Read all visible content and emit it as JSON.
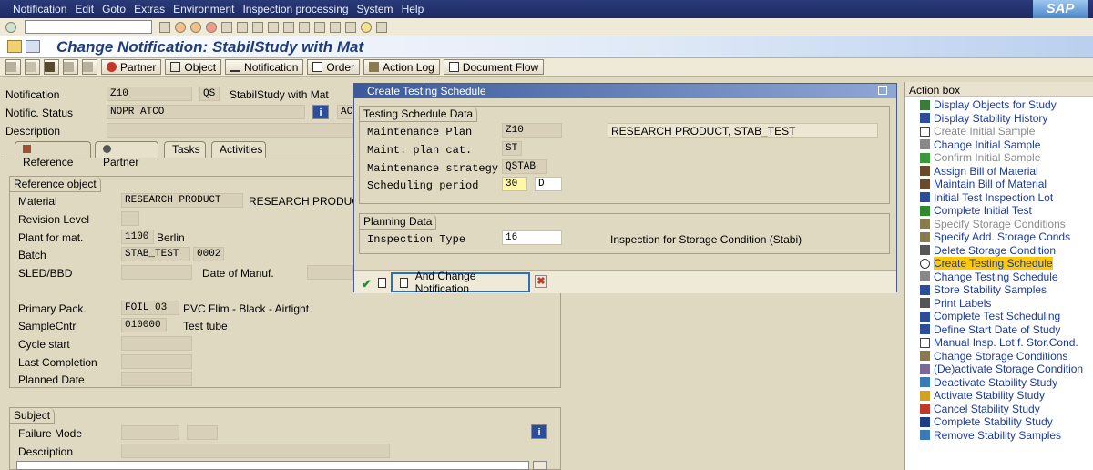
{
  "menu": [
    "Notification",
    "Edit",
    "Goto",
    "Extras",
    "Environment",
    "Inspection processing",
    "System",
    "Help"
  ],
  "brand": "SAP",
  "title": "Change Notification: StabilStudy with Mat",
  "toolbar": {
    "partner": "Partner",
    "object": "Object",
    "notification": "Notification",
    "order": "Order",
    "action_log": "Action Log",
    "document_flow": "Document Flow"
  },
  "header": {
    "notification_label": "Notification",
    "notification_value": "Z10",
    "notification_type": "QS",
    "notification_desc": "StabilStudy with Mat",
    "status_label": "Notific. Status",
    "status_value": "NOPR ATCO",
    "status_trunc": "AC",
    "description_label": "Description"
  },
  "tabs": [
    "Reference",
    "Partner",
    "Tasks",
    "Activities"
  ],
  "reference": {
    "title": "Reference object",
    "material_label": "Material",
    "material_value": "RESEARCH PRODUCT",
    "material_desc": "RESEARCH PRODUCT",
    "revision_label": "Revision Level",
    "plant_label": "Plant for mat.",
    "plant_value": "1100",
    "plant_desc": "Berlin",
    "batch_label": "Batch",
    "batch_value": "STAB_TEST",
    "batch_num": "0002",
    "sled_label": "SLED/BBD",
    "manuf_label": "Date of Manuf.",
    "pack_label": "Primary Pack.",
    "pack_value": "FOIL 03",
    "pack_desc": "PVC Flim - Black - Airtight",
    "sample_label": "SampleCntr",
    "sample_value": "010000",
    "sample_desc": "Test tube",
    "cycle_label": "Cycle start",
    "last_label": "Last Completion",
    "planned_label": "Planned Date"
  },
  "subject": {
    "title": "Subject",
    "failure_label": "Failure Mode",
    "desc_label": "Description"
  },
  "dialog": {
    "title": "Create Testing Schedule",
    "group1": "Testing Schedule Data",
    "mp_label": "Maintenance Plan",
    "mp_value": "Z10",
    "mp_desc": "RESEARCH PRODUCT, STAB_TEST",
    "cat_label": "Maint. plan cat.",
    "cat_value": "ST",
    "strat_label": "Maintenance strategy",
    "strat_value": "QSTAB",
    "period_label": "Scheduling period",
    "period_value": "30",
    "period_unit": "D",
    "group2": "Planning Data",
    "insp_label": "Inspection Type",
    "insp_value": "16",
    "insp_desc": "Inspection for Storage Condition (Stabi)",
    "change_btn": "And Change Notification"
  },
  "actionbox": {
    "title": "Action box",
    "items": [
      {
        "label": "Display Objects for Study",
        "enabled": true,
        "icon": "tree-icon"
      },
      {
        "label": "Display Stability History",
        "enabled": true,
        "icon": "history-icon"
      },
      {
        "label": "Create Initial Sample",
        "enabled": false,
        "icon": "page-icon"
      },
      {
        "label": "Change Initial Sample",
        "enabled": true,
        "icon": "pencil-icon"
      },
      {
        "label": "Confirm Initial Sample",
        "enabled": false,
        "icon": "flag-icon"
      },
      {
        "label": "Assign Bill of Material",
        "enabled": true,
        "icon": "bom-icon"
      },
      {
        "label": "Maintain Bill of Material",
        "enabled": true,
        "icon": "bom-edit-icon"
      },
      {
        "label": "Initial Test Inspection Lot",
        "enabled": true,
        "icon": "chart-icon"
      },
      {
        "label": "Complete Initial Test",
        "enabled": true,
        "icon": "check-icon"
      },
      {
        "label": "Specify Storage Conditions",
        "enabled": false,
        "icon": "grid-icon"
      },
      {
        "label": "Specify Add. Storage Conds",
        "enabled": true,
        "icon": "grid-add-icon"
      },
      {
        "label": "Delete Storage Condition",
        "enabled": true,
        "icon": "trash-icon"
      },
      {
        "label": "Create Testing Schedule",
        "enabled": true,
        "icon": "clock-icon",
        "selected": true
      },
      {
        "label": "Change Testing Schedule",
        "enabled": true,
        "icon": "pencil-icon"
      },
      {
        "label": "Store Stability Samples",
        "enabled": true,
        "icon": "store-icon"
      },
      {
        "label": "Print Labels",
        "enabled": true,
        "icon": "print-icon"
      },
      {
        "label": "Complete Test Scheduling",
        "enabled": true,
        "icon": "doc-check-icon"
      },
      {
        "label": "Define Start Date of Study",
        "enabled": true,
        "icon": "calendar-icon"
      },
      {
        "label": "Manual Insp. Lot f. Stor.Cond.",
        "enabled": true,
        "icon": "page-icon"
      },
      {
        "label": "Change Storage Conditions",
        "enabled": true,
        "icon": "grid-edit-icon"
      },
      {
        "label": "(De)activate Storage Condition",
        "enabled": true,
        "icon": "lock-icon"
      },
      {
        "label": "Deactivate Stability Study",
        "enabled": true,
        "icon": "down-icon"
      },
      {
        "label": "Activate Stability Study",
        "enabled": true,
        "icon": "up-icon"
      },
      {
        "label": "Cancel Stability Study",
        "enabled": true,
        "icon": "cross-icon"
      },
      {
        "label": "Complete Stability Study",
        "enabled": true,
        "icon": "complete-icon"
      },
      {
        "label": "Remove Stability Samples",
        "enabled": true,
        "icon": "remove-icon"
      }
    ]
  }
}
